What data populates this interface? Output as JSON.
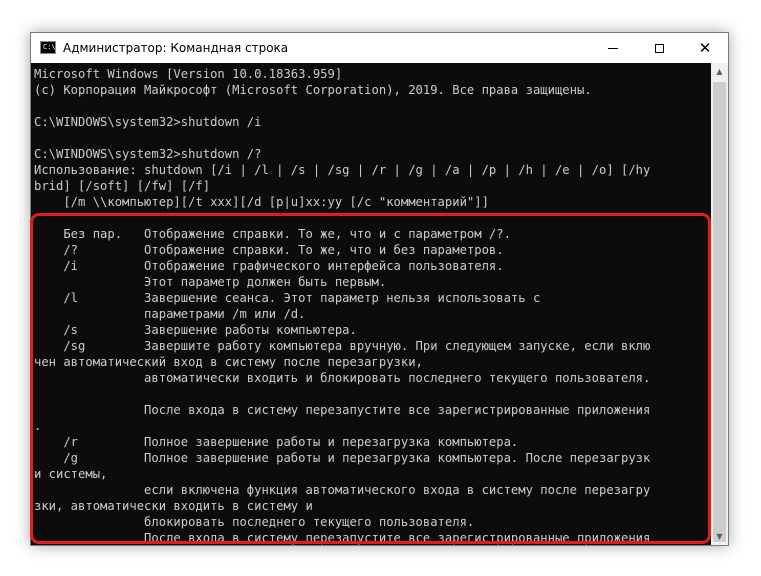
{
  "window": {
    "title": "Администратор: Командная строка",
    "icon_text": "C:\\",
    "minimize_icon": "minimize-icon",
    "maximize_icon": "maximize-icon",
    "close_icon": "close-icon",
    "close_glyph": "✕"
  },
  "console": {
    "lines": [
      "Microsoft Windows [Version 10.0.18363.959]",
      "(c) Корпорация Майкрософт (Microsoft Corporation), 2019. Все права защищены.",
      "",
      "C:\\WINDOWS\\system32>shutdown /i",
      "",
      "C:\\WINDOWS\\system32>shutdown /?",
      "Использование: shutdown [/i | /l | /s | /sg | /r | /g | /a | /p | /h | /e | /o] [/hy",
      "brid] [/soft] [/fw] [/f]",
      "    [/m \\\\компьютер][/t xxx][/d [p|u]xx:yy [/c \"комментарий\"]]",
      "",
      "    Без пар.   Отображение справки. То же, что и с параметром /?.",
      "    /?         Отображение справки. То же, что и без параметров.",
      "    /i         Отображение графического интерфейса пользователя.",
      "               Этот параметр должен быть первым.",
      "    /l         Завершение сеанса. Этот параметр нельзя использовать с",
      "               параметрами /m или /d.",
      "    /s         Завершение работы компьютера.",
      "    /sg        Завершите работу компьютера вручную. При следующем запуске, если вклю",
      "чен автоматический вход в систему после перезагрузки,",
      "               автоматически входить и блокировать последнего текущего пользователя.",
      "",
      "               После входа в систему перезапустите все зарегистрированные приложения",
      ".",
      "    /r         Полное завершение работы и перезагрузка компьютера.",
      "    /g         Полное завершение работы и перезагрузка компьютера. После перезагрузк",
      "и системы,",
      "               если включена функция автоматического входа в систему после перезагру",
      "зки, автоматически входить в систему и",
      "               блокировать последнего текущего пользователя.",
      "               После входа в систему перезапустите все зарегистрированные приложения"
    ]
  },
  "colors": {
    "console_bg": "#0c0c0c",
    "console_text": "#cccccc",
    "highlight": "#e21b1b"
  }
}
